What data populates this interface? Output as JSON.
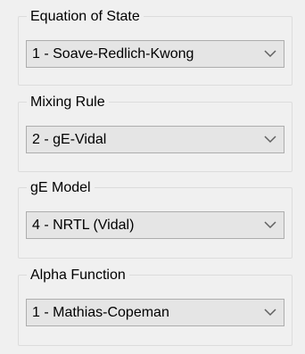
{
  "groups": [
    {
      "id": "equation-of-state",
      "label": "Equation of State",
      "selected": "1 - Soave-Redlich-Kwong"
    },
    {
      "id": "mixing-rule",
      "label": "Mixing Rule",
      "selected": "2 - gE-Vidal"
    },
    {
      "id": "ge-model",
      "label": "gE Model",
      "selected": "4 - NRTL (Vidal)"
    },
    {
      "id": "alpha-function",
      "label": "Alpha Function",
      "selected": "1 - Mathias-Copeman"
    }
  ],
  "icons": {
    "dropdown": "chevron-down-icon"
  }
}
